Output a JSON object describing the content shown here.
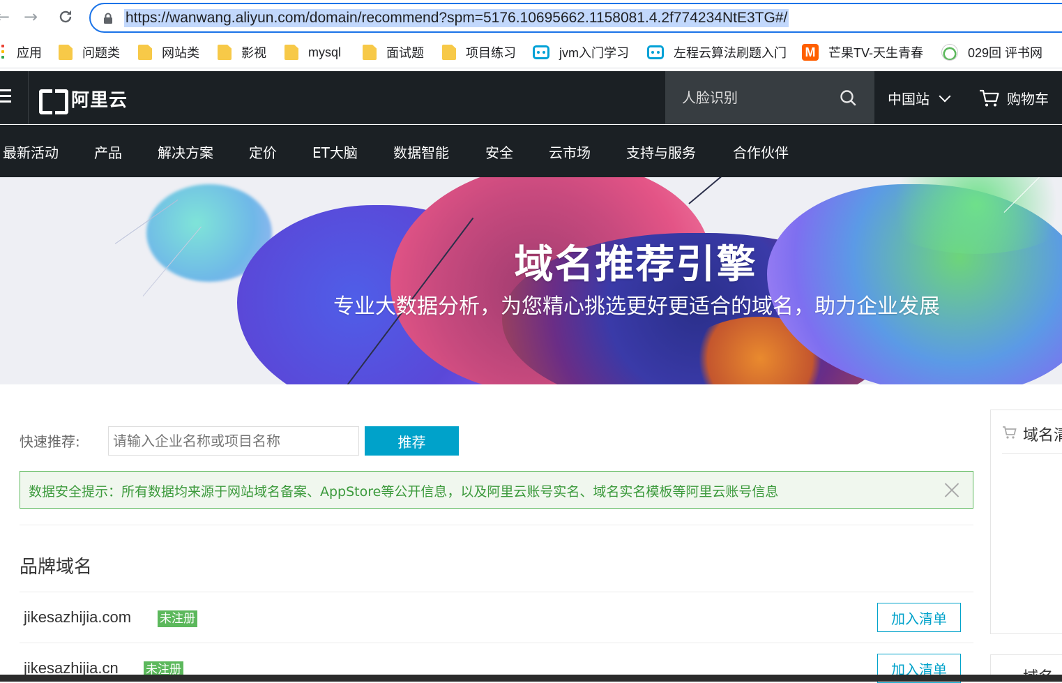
{
  "browser": {
    "url": "https://wanwang.aliyun.com/domain/recommend?spm=5176.10695662.1158081.4.2f774234NtE3TG#/",
    "bookmarks": [
      {
        "label": "应用",
        "icon": "apps-icon"
      },
      {
        "label": "问题类",
        "icon": "folder-icon"
      },
      {
        "label": "网站类",
        "icon": "folder-icon"
      },
      {
        "label": "影视",
        "icon": "folder-icon"
      },
      {
        "label": "mysql",
        "icon": "folder-icon"
      },
      {
        "label": "面试题",
        "icon": "folder-icon"
      },
      {
        "label": "项目练习",
        "icon": "folder-icon"
      },
      {
        "label": "jvm入门学习",
        "icon": "bilibili-icon"
      },
      {
        "label": "左程云算法刷题入门",
        "icon": "bilibili-icon"
      },
      {
        "label": "芒果TV-天生青春",
        "icon": "mango-tv-icon"
      },
      {
        "label": "029回 评书网",
        "icon": "pingshu-icon"
      }
    ]
  },
  "header": {
    "logo_text": "阿里云",
    "search_placeholder": "人脸识别",
    "region": "中国站",
    "cart": "购物车",
    "nav": [
      "最新活动",
      "产品",
      "解决方案",
      "定价",
      "ET大脑",
      "数据智能",
      "安全",
      "云市场",
      "支持与服务",
      "合作伙伴"
    ]
  },
  "hero": {
    "title": "域名推荐引擎",
    "subtitle": "专业大数据分析，为您精心挑选更好更适合的域名，助力企业发展"
  },
  "quick": {
    "label": "快速推荐:",
    "placeholder": "请输入企业名称或项目名称",
    "button": "推荐"
  },
  "notice": {
    "text": "数据安全提示：所有数据均来源于网站域名备案、AppStore等公开信息，以及阿里云账号实名、域名实名模板等阿里云账号信息"
  },
  "brand_section": {
    "title": "品牌域名",
    "rows": [
      {
        "domain": "jikesazhijia.com",
        "status": "未注册",
        "action": "加入清单"
      },
      {
        "domain": "jikesazhijia.cn",
        "status": "未注册",
        "action": "加入清单"
      }
    ]
  },
  "side_panel": {
    "title": "域名清",
    "title2": "域名..."
  },
  "colors": {
    "accent": "#00a2ca",
    "header_bg": "#1b2024",
    "success": "#5cb85c"
  }
}
